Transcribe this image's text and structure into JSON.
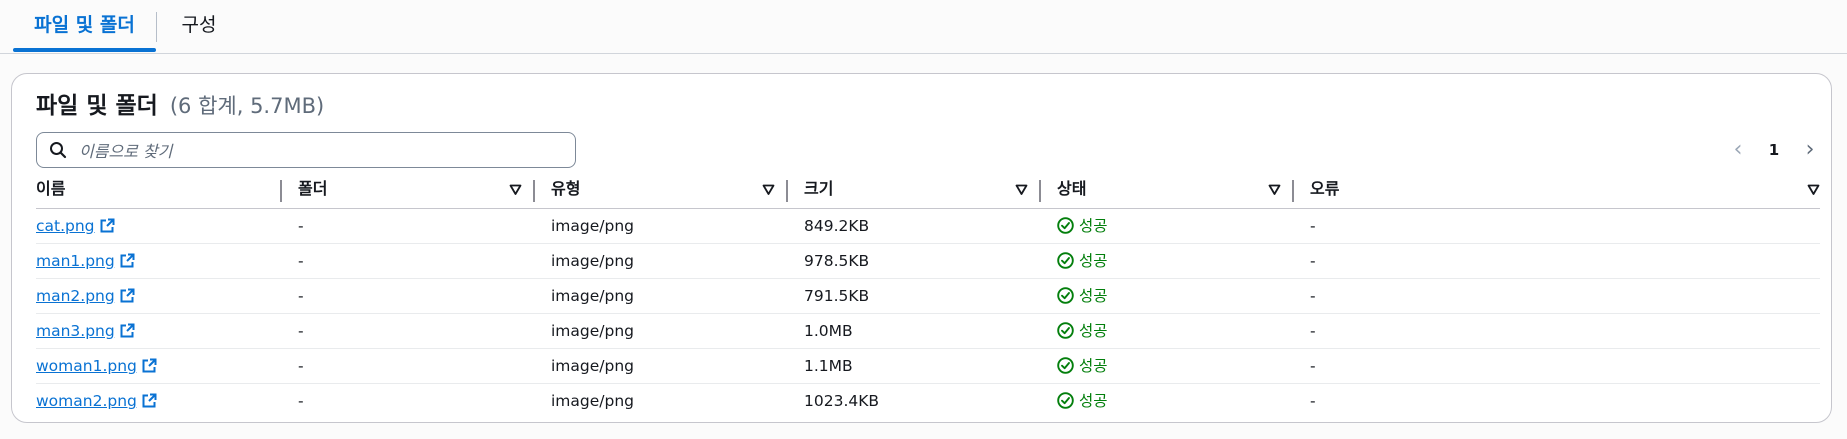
{
  "tabs": [
    {
      "label": "파일 및 폴더"
    },
    {
      "label": "구성"
    }
  ],
  "panel": {
    "title": "파일 및 폴더",
    "count": "(6 합계, 5.7MB)"
  },
  "search": {
    "placeholder": "이름으로 찾기",
    "value": ""
  },
  "pagination": {
    "current_page": "1",
    "prev_icon": "chevron-left-icon",
    "next_icon": "chevron-right-icon"
  },
  "table": {
    "columns": [
      {
        "label": "이름"
      },
      {
        "label": "폴더"
      },
      {
        "label": "유형"
      },
      {
        "label": "크기"
      },
      {
        "label": "상태"
      },
      {
        "label": "오류"
      }
    ],
    "rows": [
      {
        "name": "cat.png",
        "folder": "-",
        "type": "image/png",
        "size": "849.2KB",
        "status": "성공",
        "error": "-"
      },
      {
        "name": "man1.png",
        "folder": "-",
        "type": "image/png",
        "size": "978.5KB",
        "status": "성공",
        "error": "-"
      },
      {
        "name": "man2.png",
        "folder": "-",
        "type": "image/png",
        "size": "791.5KB",
        "status": "성공",
        "error": "-"
      },
      {
        "name": "man3.png",
        "folder": "-",
        "type": "image/png",
        "size": "1.0MB",
        "status": "성공",
        "error": "-"
      },
      {
        "name": "woman1.png",
        "folder": "-",
        "type": "image/png",
        "size": "1.1MB",
        "status": "성공",
        "error": "-"
      },
      {
        "name": "woman2.png",
        "folder": "-",
        "type": "image/png",
        "size": "1023.4KB",
        "status": "성공",
        "error": "-"
      }
    ]
  },
  "colors": {
    "accent": "#0972d3",
    "success": "#037f0c",
    "text": "#16191f"
  }
}
